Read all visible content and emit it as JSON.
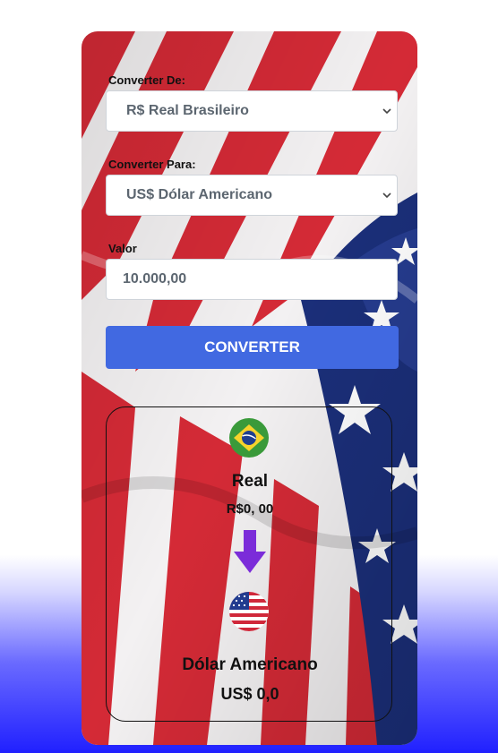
{
  "form": {
    "from_label": "Converter De:",
    "from_value": "R$ Real Brasileiro",
    "to_label": "Converter Para:",
    "to_value": "US$ Dólar Americano",
    "amount_label": "Valor",
    "amount_value": "10.000,00",
    "convert_button": "CONVERTER"
  },
  "result": {
    "from_currency_name": "Real",
    "from_currency_value": "R$0, 00",
    "to_currency_name": "Dólar Americano",
    "to_currency_value": "US$ 0,0"
  },
  "icons": {
    "from_flag": "brazil-flag-icon",
    "arrow": "arrow-down-icon",
    "to_flag": "usa-flag-icon",
    "select_caret": "chevron-down-icon"
  },
  "colors": {
    "button": "#4169e1",
    "arrow": "#7b2cd9",
    "page_gradient_bottom": "#2020ff"
  }
}
